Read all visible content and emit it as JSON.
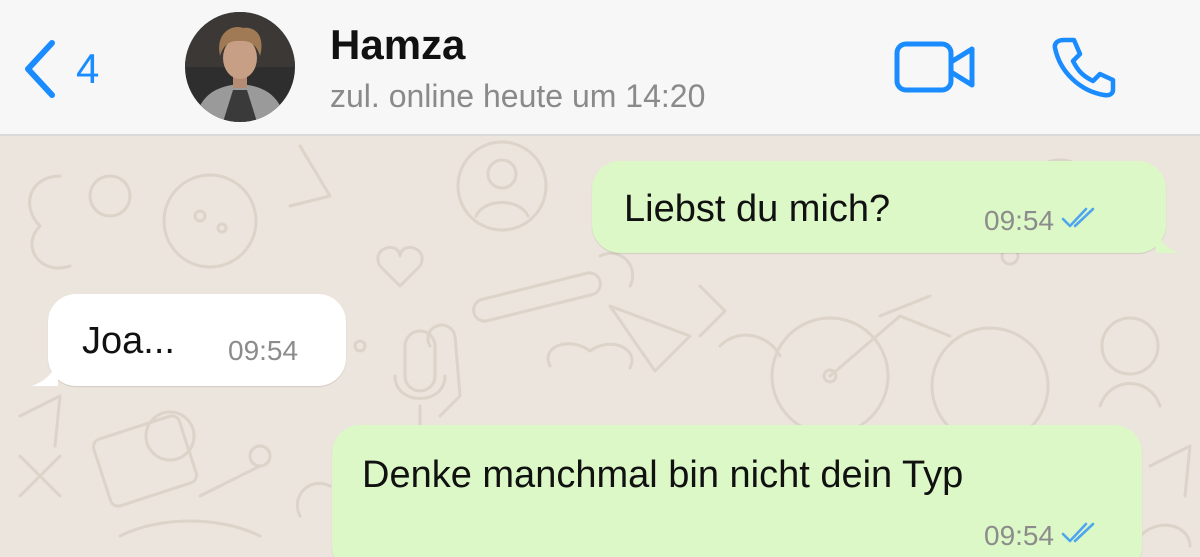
{
  "header": {
    "unread_count": "4",
    "contact_name": "Hamza",
    "contact_status": "zul. online heute um 14:20",
    "icons": {
      "back": "chevron-left-icon",
      "video": "video-camera-icon",
      "phone": "phone-icon"
    }
  },
  "messages": [
    {
      "direction": "outgoing",
      "text": "Liebst du mich?",
      "time": "09:54",
      "status": "read"
    },
    {
      "direction": "incoming",
      "text": "Joa...",
      "time": "09:54"
    },
    {
      "direction": "outgoing",
      "text": "Denke manchmal bin nicht dein Typ",
      "time": "09:54",
      "status": "read"
    }
  ],
  "colors": {
    "accent": "#1a8cff",
    "outgoing_bubble": "#dcf8c6",
    "incoming_bubble": "#ffffff",
    "chat_background": "#ece5dd",
    "read_ticks": "#4fa6f0"
  }
}
